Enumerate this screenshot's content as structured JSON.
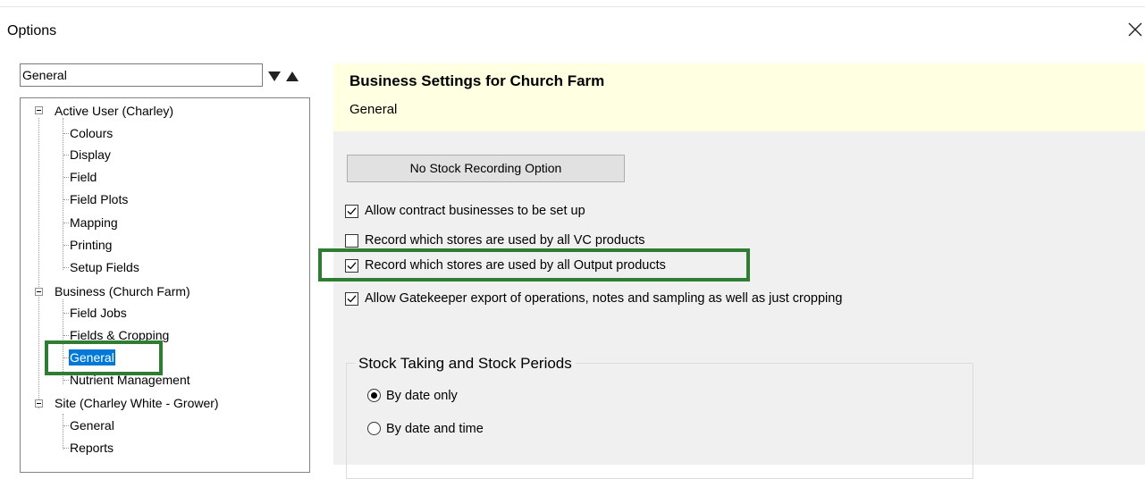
{
  "window": {
    "title": "Options",
    "close_icon": "close-icon"
  },
  "nav": {
    "dropdown_value": "General",
    "tree": {
      "active_user": {
        "label": "Active User (Charley)",
        "children": [
          "Colours",
          "Display",
          "Field",
          "Field Plots",
          "Mapping",
          "Printing",
          "Setup Fields"
        ]
      },
      "business": {
        "label": "Business (Church Farm)",
        "children": [
          "Field Jobs",
          "Fields & Cropping",
          "General",
          "Nutrient Management"
        ]
      },
      "site": {
        "label": "Site (Charley White - Grower)",
        "children": [
          "General",
          "Reports"
        ]
      }
    },
    "selected": "General"
  },
  "header": {
    "title": "Business Settings for Church Farm",
    "subtitle": "General"
  },
  "stock_button": "No Stock Recording Option",
  "options": [
    {
      "label": "Allow contract businesses to be set up",
      "checked": true
    },
    {
      "label": "Record which stores are used by all VC products",
      "checked": false
    },
    {
      "label": "Record which stores are used by all Output products",
      "checked": true
    },
    {
      "label": "Allow Gatekeeper export of operations, notes and sampling as well as just cropping",
      "checked": true
    }
  ],
  "stock_group": {
    "title": "Stock Taking and Stock Periods",
    "radios": [
      {
        "label": "By date only",
        "selected": true
      },
      {
        "label": "By date and time",
        "selected": false
      }
    ]
  },
  "colors": {
    "header_bg": "#ffffe1",
    "panel_bg": "#f0f0f0",
    "selection": "#0078d7",
    "highlight_box": "#2e7d32"
  }
}
